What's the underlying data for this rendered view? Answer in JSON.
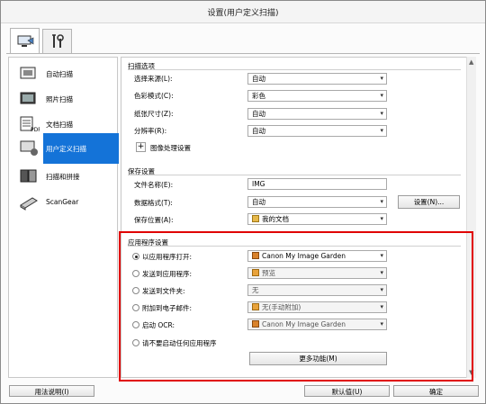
{
  "window": {
    "title": "设置(用户定义扫描)"
  },
  "tabs": [
    {
      "icon": "scan-settings-tab-icon"
    },
    {
      "icon": "tools-tab-icon"
    }
  ],
  "sidebar": {
    "items": [
      {
        "label": "自动扫描",
        "icon": "auto-scan-icon"
      },
      {
        "label": "照片扫描",
        "icon": "photo-scan-icon"
      },
      {
        "label": "文档扫描",
        "icon": "document-scan-icon"
      },
      {
        "label": "用户定义扫描",
        "icon": "custom-scan-icon",
        "selected": true
      },
      {
        "label": "扫描和拼接",
        "icon": "scan-stitch-icon"
      },
      {
        "label": "ScanGear",
        "icon": "scangear-icon"
      }
    ]
  },
  "scan_options": {
    "title": "扫描选项",
    "rows": [
      {
        "label": "选择来源(L):",
        "value": "自动"
      },
      {
        "label": "色彩模式(C):",
        "value": "彩色"
      },
      {
        "label": "纸张尺寸(Z):",
        "value": "自动"
      },
      {
        "label": "分辨率(R):",
        "value": "自动"
      }
    ],
    "image_processing": "图像处理设置"
  },
  "save_settings": {
    "title": "保存设置",
    "rows": [
      {
        "label": "文件名称(E):",
        "value": "IMG"
      },
      {
        "label": "数据格式(T):",
        "value": "自动"
      },
      {
        "label": "保存位置(A):",
        "value": "我的文档"
      }
    ],
    "settings_button": "设置(N)..."
  },
  "app_settings": {
    "title": "应用程序设置",
    "rows": [
      {
        "label": "以应用程序打开:",
        "value": "Canon My Image Garden",
        "checked": true,
        "disabled": false
      },
      {
        "label": "发送到应用程序:",
        "value": "预览",
        "checked": false,
        "disabled": true
      },
      {
        "label": "发送到文件夹:",
        "value": "无",
        "checked": false,
        "disabled": true
      },
      {
        "label": "附加到电子邮件:",
        "value": "无(手动附加)",
        "checked": false,
        "disabled": true
      },
      {
        "label": "启动 OCR:",
        "value": "Canon My Image Garden",
        "checked": false,
        "disabled": true
      },
      {
        "label": "请不要启动任何应用程序",
        "checked": false
      }
    ],
    "more_functions": "更多功能(M)"
  },
  "footer": {
    "help": "用法说明(I)",
    "defaults": "默认值(U)",
    "ok": "确定"
  },
  "colors": {
    "highlight": "#1473d8",
    "annotation_box": "#e00000"
  }
}
